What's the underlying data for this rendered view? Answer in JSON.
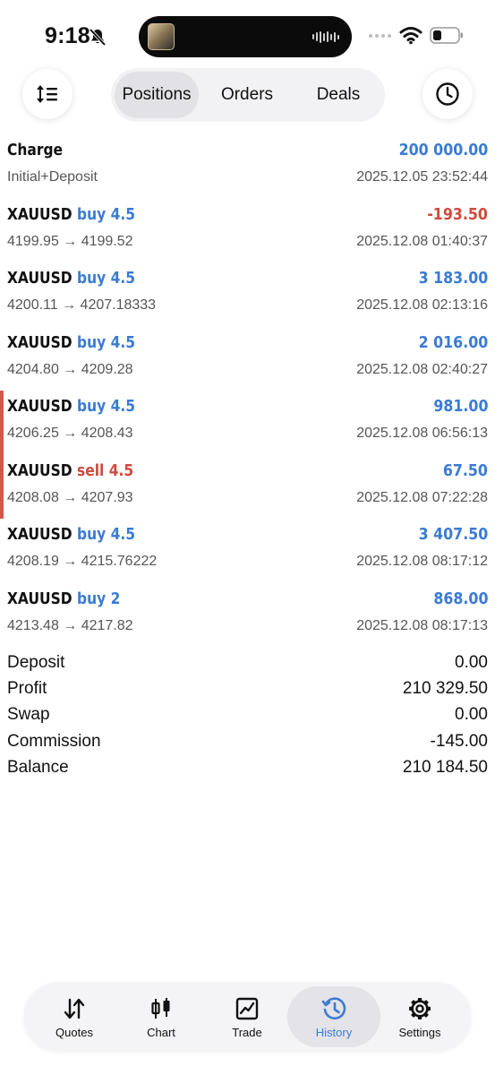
{
  "status": {
    "time": "9:18"
  },
  "toolbar": {
    "tabs": [
      "Positions",
      "Orders",
      "Deals"
    ],
    "active_tab": "Positions"
  },
  "deals": [
    {
      "title": "Charge",
      "direction": "",
      "lot": "",
      "type": "charge",
      "amount": "200 000.00",
      "sub": "Initial+Deposit",
      "time": "2025.12.05 23:52:44"
    },
    {
      "title": "XAUUSD",
      "direction": "buy",
      "lot": "4.5",
      "type": "buy",
      "amount": "-193.50",
      "sub": "4199.95 → 4199.52",
      "time": "2025.12.08 01:40:37"
    },
    {
      "title": "XAUUSD",
      "direction": "buy",
      "lot": "4.5",
      "type": "buy",
      "amount": "3 183.00",
      "sub": "4200.11 → 4207.18333",
      "time": "2025.12.08 02:13:16"
    },
    {
      "title": "XAUUSD",
      "direction": "buy",
      "lot": "4.5",
      "type": "buy",
      "amount": "2 016.00",
      "sub": "4204.80 → 4209.28",
      "time": "2025.12.08 02:40:27"
    },
    {
      "title": "XAUUSD",
      "direction": "buy",
      "lot": "4.5",
      "type": "buy",
      "amount": "981.00",
      "sub": "4206.25 → 4208.43",
      "time": "2025.12.08 06:56:13"
    },
    {
      "title": "XAUUSD",
      "direction": "sell",
      "lot": "4.5",
      "type": "sell",
      "amount": "67.50",
      "sub": "4208.08 → 4207.93",
      "time": "2025.12.08 07:22:28"
    },
    {
      "title": "XAUUSD",
      "direction": "buy",
      "lot": "4.5",
      "type": "buy",
      "amount": "3 407.50",
      "sub": "4208.19 → 4215.76222",
      "time": "2025.12.08 08:17:12"
    },
    {
      "title": "XAUUSD",
      "direction": "buy",
      "lot": "2",
      "type": "buy",
      "amount": "868.00",
      "sub": "4213.48 → 4217.82",
      "time": "2025.12.08 08:17:13"
    }
  ],
  "summary": [
    {
      "label": "Deposit",
      "value": "0.00"
    },
    {
      "label": "Profit",
      "value": "210 329.50"
    },
    {
      "label": "Swap",
      "value": "0.00"
    },
    {
      "label": "Commission",
      "value": "-145.00"
    },
    {
      "label": "Balance",
      "value": "210 184.50"
    }
  ],
  "tabbar": {
    "items": [
      {
        "label": "Quotes",
        "icon": "quotes-icon"
      },
      {
        "label": "Chart",
        "icon": "candlestick-icon"
      },
      {
        "label": "Trade",
        "icon": "trade-icon"
      },
      {
        "label": "History",
        "icon": "history-icon"
      },
      {
        "label": "Settings",
        "icon": "gear-icon"
      }
    ],
    "active": "History"
  },
  "colors": {
    "accent": "#3a7bd5",
    "negative": "#d04a3c",
    "muted": "#555555"
  }
}
